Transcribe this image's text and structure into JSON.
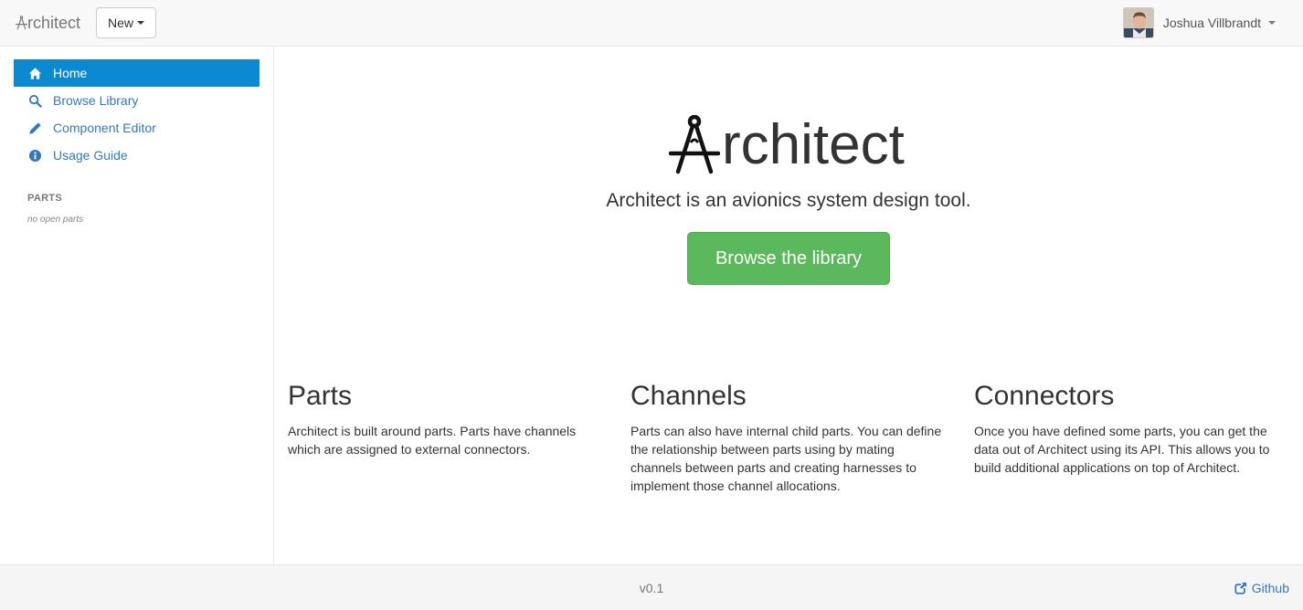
{
  "navbar": {
    "brand": "rchitect",
    "new_label": "New",
    "user_name": "Joshua Villbrandt"
  },
  "sidebar": {
    "items": [
      {
        "label": "Home",
        "icon": "home-icon",
        "active": true
      },
      {
        "label": "Browse Library",
        "icon": "search-icon",
        "active": false
      },
      {
        "label": "Component Editor",
        "icon": "pencil-icon",
        "active": false
      },
      {
        "label": "Usage Guide",
        "icon": "info-icon",
        "active": false
      }
    ],
    "parts_header": "PARTS",
    "parts_empty": "no open parts"
  },
  "hero": {
    "title": "rchitect",
    "tagline": "Architect is an avionics system design tool.",
    "button_label": "Browse the library"
  },
  "features": [
    {
      "title": "Parts",
      "text": "Architect is built around parts. Parts have channels which are assigned to external connectors."
    },
    {
      "title": "Channels",
      "text": "Parts can also have internal child parts. You can define the relationship between parts using by mating channels between parts and creating harnesses to implement those channel allocations."
    },
    {
      "title": "Connectors",
      "text": "Once you have defined some parts, you can get the data out of Architect using its API. This allows you to build additional applications on top of Architect."
    }
  ],
  "footer": {
    "version": "v0.1",
    "github_label": "Github"
  },
  "colors": {
    "accent": "#0b8ad1",
    "link": "#337ab7",
    "success": "#5cb85c"
  }
}
